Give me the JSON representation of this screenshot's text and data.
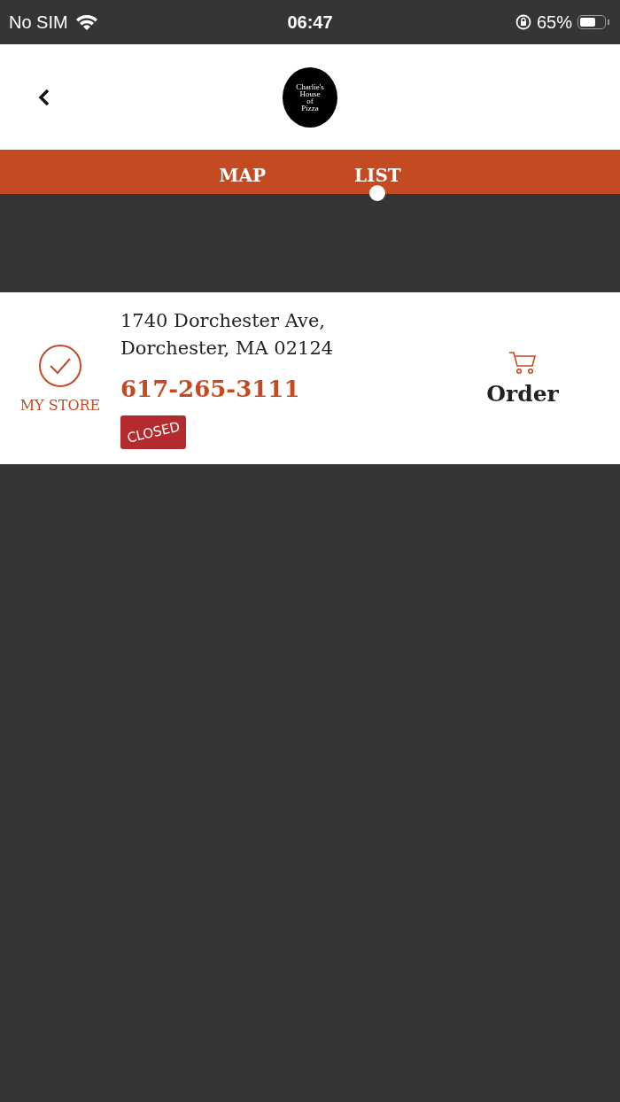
{
  "status_bar": {
    "carrier": "No SIM",
    "time": "06:47",
    "battery": "65%"
  },
  "header": {
    "logo_lines": [
      "Charlie's",
      "House",
      "of",
      "Pizza"
    ]
  },
  "tabs": [
    {
      "label": "MAP",
      "selected": false
    },
    {
      "label": "LIST",
      "selected": true
    }
  ],
  "stores": [
    {
      "my_store": {
        "label": "MY STORE",
        "selected": true
      },
      "address_lines": [
        "1740 Dorchester Ave,",
        "Dorchester, MA 02124"
      ],
      "phone": "617-265-3111",
      "status": "CLOSED",
      "order_label": "Order"
    }
  ]
}
